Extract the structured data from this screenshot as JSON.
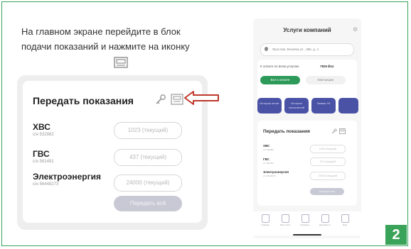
{
  "instruction": "На главном экране перейдите в блок подачи показаний и нажмите на иконку",
  "left_card": {
    "title": "Передать показания",
    "rows": [
      {
        "name": "ХВС",
        "sub": "с/н 532982",
        "field": "1023 (текущий)"
      },
      {
        "name": "ГВС",
        "sub": "с/н 581491",
        "field": "437 (текущий)"
      },
      {
        "name": "Электроэнергия",
        "sub": "с/н 56448273",
        "field": "24000 (текущий)"
      }
    ],
    "submit_label": "Передать всё"
  },
  "phone": {
    "title": "Услуги компаний",
    "address": "Ярослав, Вязовка ул., 38К, д. 4",
    "debt_label": "К оплате по всем услугам:",
    "debt_value": "7826 ₽44",
    "pay_label": "Все к оплате",
    "sub_label": "Квитанции",
    "tiles": [
      "История оплат",
      "История начислений",
      "Заявки УК"
    ],
    "card_title": "Передать показания",
    "rows": [
      {
        "name": "ХВС",
        "sub": "с/н 532982",
        "field": "1023 (текущий)"
      },
      {
        "name": "ГВС",
        "sub": "с/н 581491",
        "field": "437 (текущий)"
      },
      {
        "name": "Электроэнергия",
        "sub": "с/н 56448273",
        "field": "24000 (текущий)"
      }
    ],
    "submit_label": "Передать всё",
    "nav": [
      "Главная",
      "Мои счета",
      "Профиль",
      "Документы",
      "Ещё"
    ]
  },
  "badge": "2",
  "colors": {
    "frame": "#3aa35a",
    "arrow": "#c0392b",
    "accent_blue": "#4a52a6",
    "pay_green": "#2e9a5a"
  }
}
